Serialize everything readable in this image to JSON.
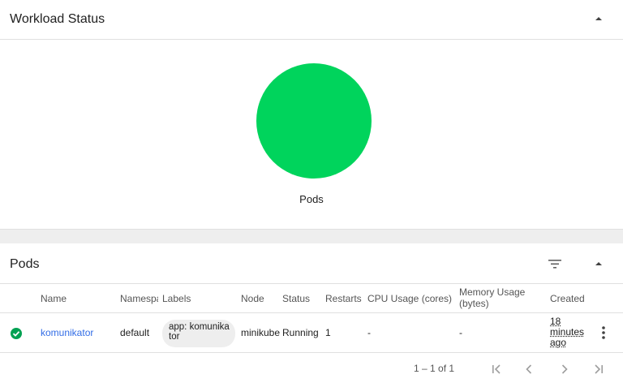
{
  "workload": {
    "title": "Workload Status",
    "pie_label": "Pods",
    "pie_color": "#00d45c"
  },
  "pods": {
    "title": "Pods",
    "columns": [
      "Name",
      "Namespace",
      "Labels",
      "Node",
      "Status",
      "Restarts",
      "CPU Usage (cores)",
      "Memory Usage (bytes)",
      "Created"
    ],
    "rows": [
      {
        "name": "komunikator",
        "namespace": "default",
        "labels": "app: komunikator",
        "node": "minikube",
        "status": "Running",
        "restarts": "1",
        "cpu": "-",
        "memory": "-",
        "created": "18 minutes ago"
      }
    ],
    "pagination": {
      "range": "1 – 1 of 1"
    }
  },
  "colors": {
    "success": "#00a152",
    "link": "#326de6"
  },
  "icons": [
    "chevron-up-icon",
    "filter-icon",
    "check-circle-icon",
    "more-vert-icon",
    "first-page-icon",
    "prev-page-icon",
    "next-page-icon",
    "last-page-icon"
  ]
}
